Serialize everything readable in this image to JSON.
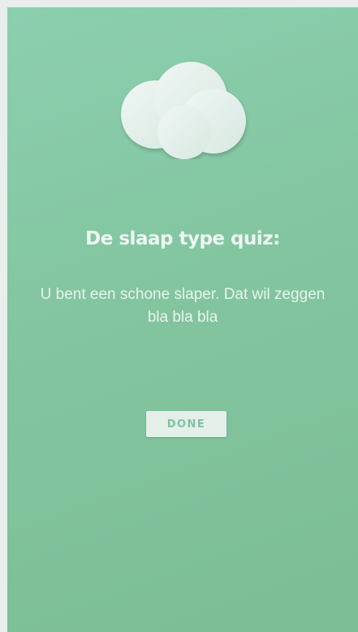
{
  "quiz": {
    "icon": "cloud-icon",
    "title": "De slaap type quiz:",
    "message": "U bent een schone slaper. Dat wil zeggen bla bla bla",
    "done_label": "DONE"
  },
  "colors": {
    "background_top": "#8ccfb0",
    "background_bottom": "#7dbd95",
    "cloud": "#e8f1ee",
    "button_bg": "#e4efe9",
    "button_text": "#7cc39f"
  }
}
